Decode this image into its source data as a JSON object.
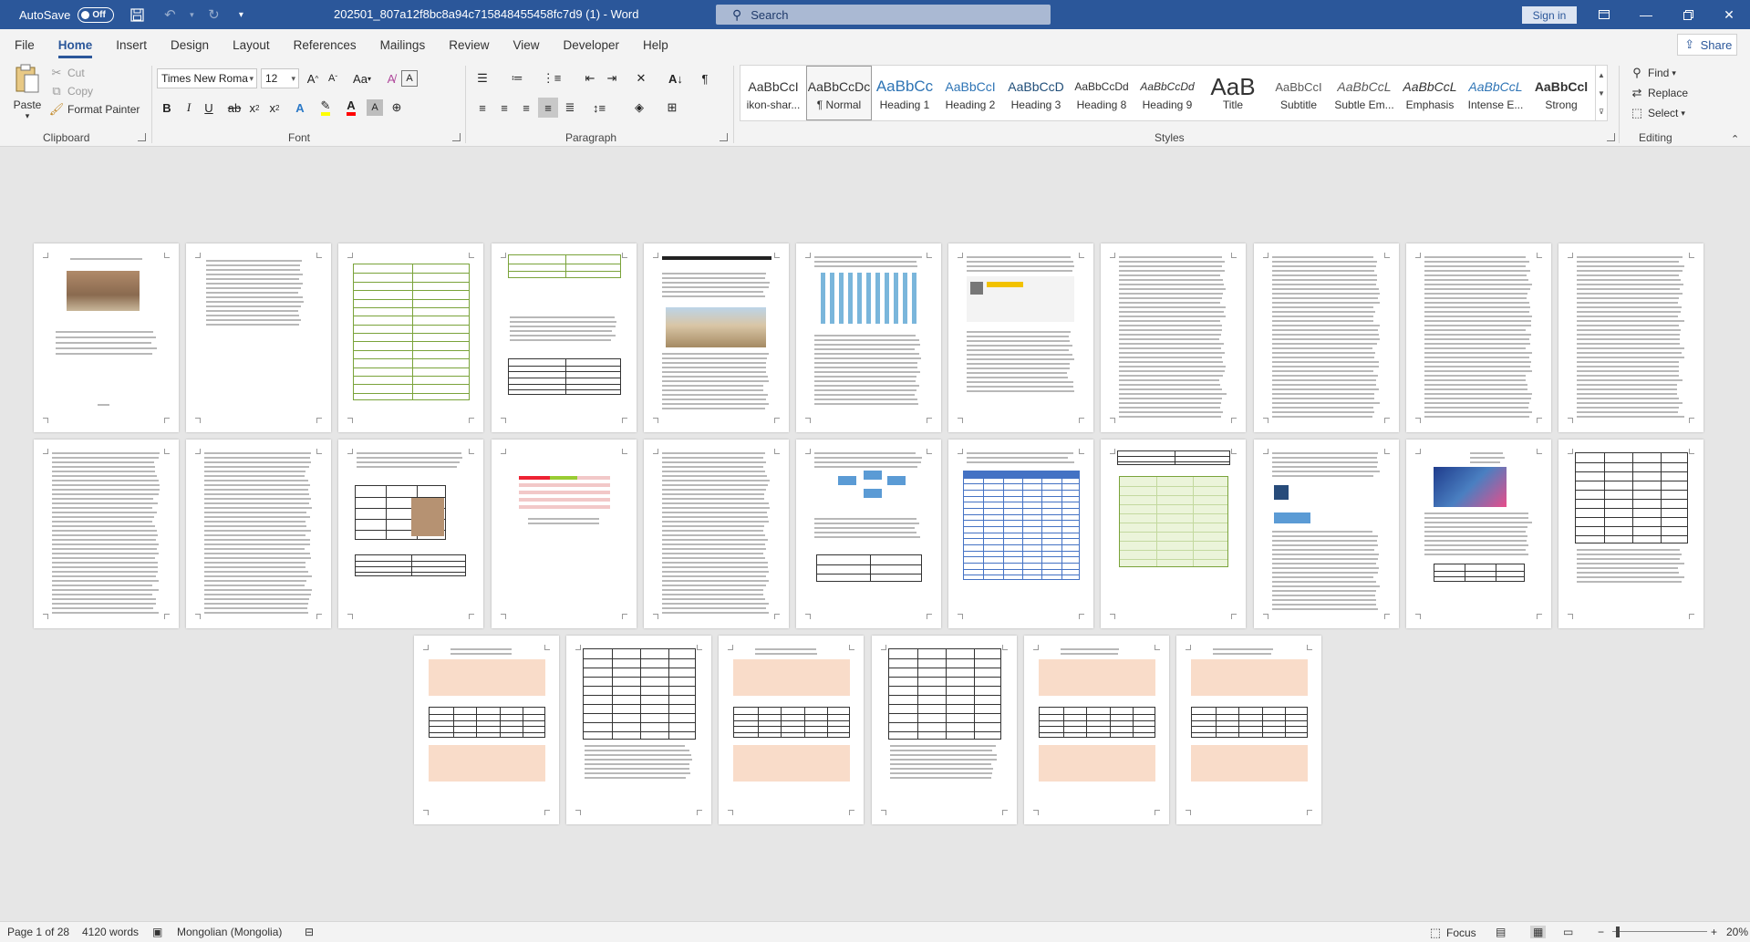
{
  "titlebar": {
    "autosave_label": "AutoSave",
    "autosave_state": "Off",
    "document_title": "202501_807a12f8bc8a94c715848455458fc7d9 (1)  -  Word",
    "search_placeholder": "Search",
    "signin_label": "Sign in"
  },
  "tabs": [
    "File",
    "Home",
    "Insert",
    "Design",
    "Layout",
    "References",
    "Mailings",
    "Review",
    "View",
    "Developer",
    "Help"
  ],
  "share_label": "Share",
  "clipboard": {
    "paste": "Paste",
    "cut": "Cut",
    "copy": "Copy",
    "format_painter": "Format Painter",
    "group": "Clipboard"
  },
  "font": {
    "name": "Times New Roma",
    "size": "12",
    "group": "Font"
  },
  "paragraph": {
    "group": "Paragraph"
  },
  "styles": {
    "group": "Styles",
    "items": [
      {
        "preview": "AaBbCcI",
        "name": "ikon-shar..."
      },
      {
        "preview": "AaBbCcDc",
        "name": "¶ Normal"
      },
      {
        "preview": "AaBbCc",
        "name": "Heading 1"
      },
      {
        "preview": "AaBbCcI",
        "name": "Heading 2"
      },
      {
        "preview": "AaBbCcD",
        "name": "Heading 3"
      },
      {
        "preview": "AaBbCcDd",
        "name": "Heading 8"
      },
      {
        "preview": "AaBbCcDd",
        "name": "Heading 9"
      },
      {
        "preview": "AaB",
        "name": "Title"
      },
      {
        "preview": "AaBbCcI",
        "name": "Subtitle"
      },
      {
        "preview": "AaBbCcL",
        "name": "Subtle Em..."
      },
      {
        "preview": "AaBbCcL",
        "name": "Emphasis"
      },
      {
        "preview": "AaBbCcL",
        "name": "Intense E..."
      },
      {
        "preview": "AaBbCcl",
        "name": "Strong"
      }
    ]
  },
  "editing": {
    "find": "Find",
    "replace": "Replace",
    "select": "Select",
    "group": "Editing"
  },
  "status": {
    "page": "Page 1 of 28",
    "words": "4120 words",
    "language": "Mongolian (Mongolia)",
    "focus": "Focus",
    "zoom": "20%"
  },
  "colors": {
    "accent": "#2b579a",
    "highlight_yellow": "#ffff00",
    "font_red": "#ff0000"
  }
}
